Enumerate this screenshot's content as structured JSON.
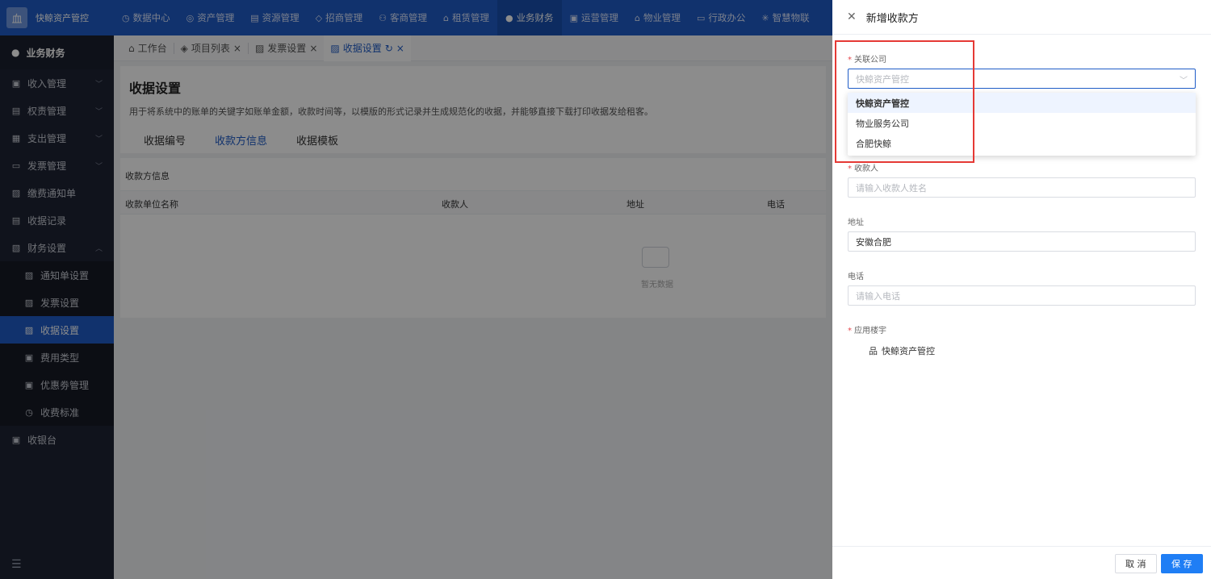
{
  "app": {
    "name": "快鲸资产管控",
    "logo_glyph": "血"
  },
  "topnav": [
    {
      "label": "数据中心",
      "icon": "◷"
    },
    {
      "label": "资产管理",
      "icon": "◎"
    },
    {
      "label": "资源管理",
      "icon": "▤"
    },
    {
      "label": "招商管理",
      "icon": "◇"
    },
    {
      "label": "客商管理",
      "icon": "⚇"
    },
    {
      "label": "租赁管理",
      "icon": "⌂"
    },
    {
      "label": "业务财务",
      "icon": "●",
      "active": true
    },
    {
      "label": "运营管理",
      "icon": "▣"
    },
    {
      "label": "物业管理",
      "icon": "⌂"
    },
    {
      "label": "行政办公",
      "icon": "▭"
    },
    {
      "label": "智慧物联",
      "icon": "✳"
    }
  ],
  "sidebar": {
    "header": "业务财务",
    "items": [
      {
        "label": "收入管理",
        "icon": "▣",
        "chevron": "﹀"
      },
      {
        "label": "权责管理",
        "icon": "▤",
        "chevron": "﹀"
      },
      {
        "label": "支出管理",
        "icon": "▦",
        "chevron": "﹀"
      },
      {
        "label": "发票管理",
        "icon": "▭",
        "chevron": "﹀"
      },
      {
        "label": "缴费通知单",
        "icon": "▨"
      },
      {
        "label": "收据记录",
        "icon": "▤"
      },
      {
        "label": "财务设置",
        "icon": "▧",
        "chevron": "︿"
      }
    ],
    "subitems": [
      {
        "label": "通知单设置",
        "icon": "▨"
      },
      {
        "label": "发票设置",
        "icon": "▨"
      },
      {
        "label": "收据设置",
        "icon": "▨",
        "active": true
      },
      {
        "label": "费用类型",
        "icon": "▣"
      },
      {
        "label": "优惠劵管理",
        "icon": "▣"
      },
      {
        "label": "收费标准",
        "icon": "◷"
      }
    ],
    "bottom_item": {
      "label": "收银台",
      "icon": "▣"
    },
    "collapse_icon": "☰"
  },
  "tabs": [
    {
      "label": "工作台",
      "icon": "⌂"
    },
    {
      "label": "项目列表",
      "icon": "◈",
      "close": "×"
    },
    {
      "label": "发票设置",
      "icon": "▨",
      "close": "×"
    },
    {
      "label": "收据设置",
      "icon": "▨",
      "refresh": "↻",
      "close": "×",
      "active": true
    }
  ],
  "page": {
    "title": "收据设置",
    "description": "用于将系统中的账单的关键字如账单金额，收款时间等，以模版的形式记录并生成规范化的收据，并能够直接下载打印收据发给租客。",
    "subtabs": [
      "收据编号",
      "收款方信息",
      "收据模板"
    ],
    "section_title": "收款方信息",
    "columns": [
      "收款单位名称",
      "收款人",
      "地址",
      "电话"
    ],
    "empty_text": "暂无数据"
  },
  "drawer": {
    "title": "新增收款方",
    "close_icon": "✕",
    "company_label": "关联公司",
    "company_placeholder": "快鲸资产管控",
    "company_options": [
      "快鲸资产管控",
      "物业服务公司",
      "合肥快鲸"
    ],
    "payee_label": "收款人",
    "payee_placeholder": "请输入收款人姓名",
    "address_label": "地址",
    "address_value": "安徽合肥",
    "phone_label": "电话",
    "phone_placeholder": "请输入电话",
    "building_label": "应用楼宇",
    "building_tree_item": "快鲸资产管控",
    "building_icon": "品",
    "cancel_label": "取 消",
    "save_label": "保 存",
    "required_mark": "*"
  },
  "colors": {
    "primary": "#1f5cc7",
    "highlight_box": "#e53935"
  }
}
